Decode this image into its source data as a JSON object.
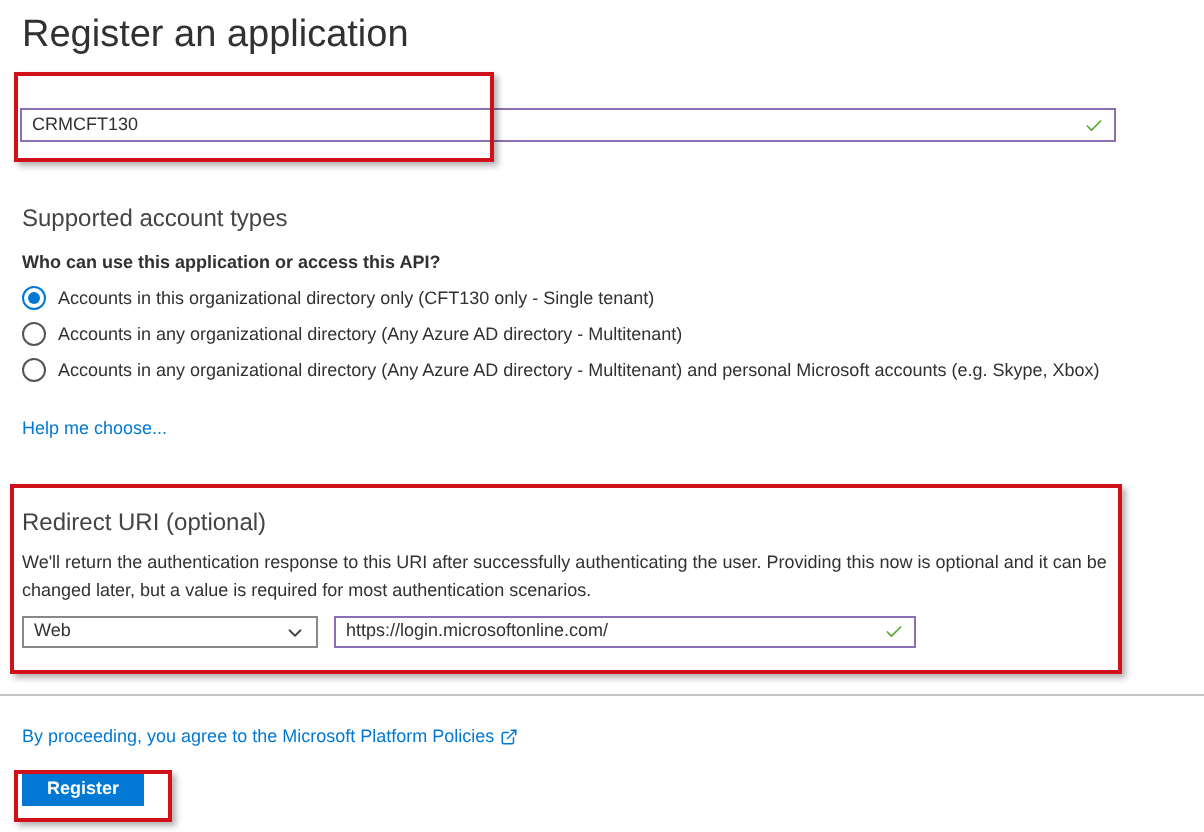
{
  "title": "Register an application",
  "name_field": {
    "value": "CRMCFT130",
    "valid": true
  },
  "account_types": {
    "heading": "Supported account types",
    "question": "Who can use this application or access this API?",
    "options": [
      {
        "label": "Accounts in this organizational directory only (CFT130 only - Single tenant)",
        "selected": true
      },
      {
        "label": "Accounts in any organizational directory (Any Azure AD directory - Multitenant)",
        "selected": false
      },
      {
        "label": "Accounts in any organizational directory (Any Azure AD directory - Multitenant) and personal Microsoft accounts (e.g. Skype, Xbox)",
        "selected": false
      }
    ],
    "help_link": "Help me choose..."
  },
  "redirect": {
    "heading": "Redirect URI (optional)",
    "description": "We'll return the authentication response to this URI after successfully authenticating the user. Providing this now is optional and it can be changed later, but a value is required for most authentication scenarios.",
    "platform": "Web",
    "uri": {
      "value": "https://login.microsoftonline.com/",
      "valid": true
    }
  },
  "policy_link": "By proceeding, you agree to the Microsoft Platform Policies",
  "register_button": "Register"
}
